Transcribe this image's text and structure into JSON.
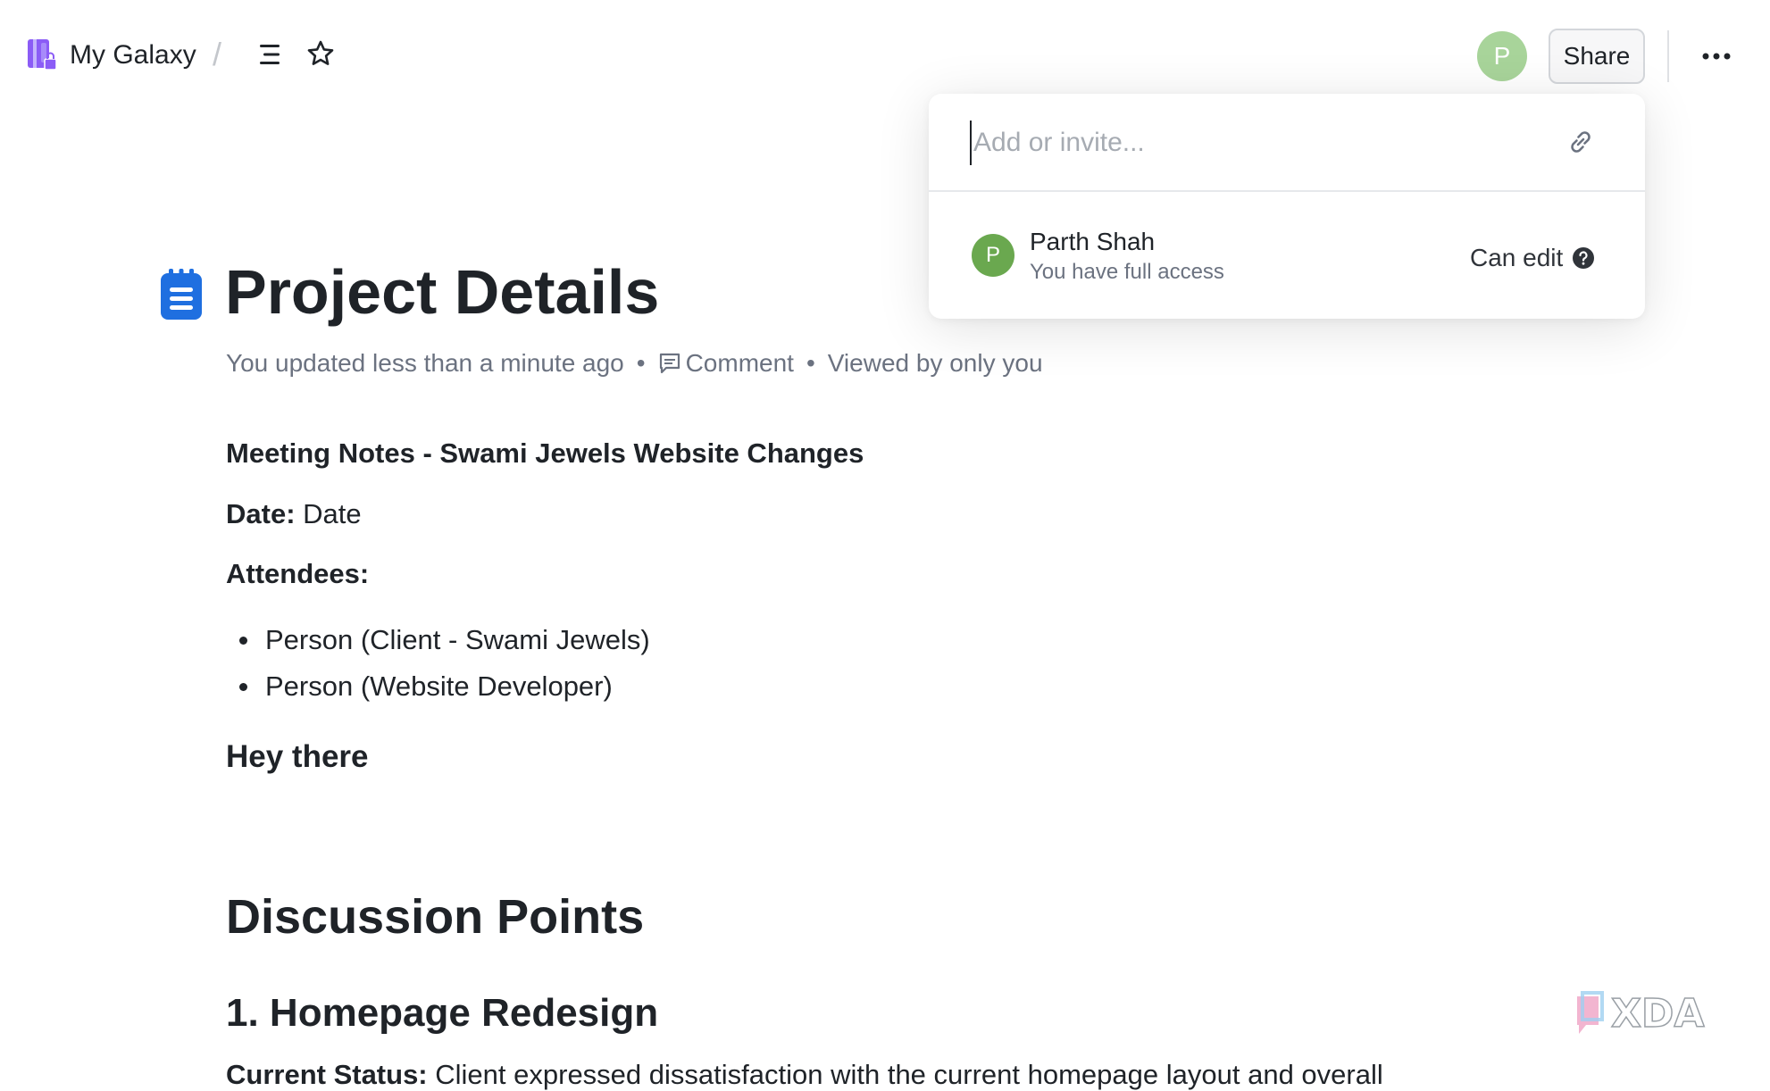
{
  "topbar": {
    "workspace_name": "My Galaxy",
    "breadcrumb_separator": "/",
    "avatar_initial": "P",
    "share_label": "Share"
  },
  "share_popover": {
    "invite_placeholder": "Add or invite...",
    "member": {
      "avatar_initial": "P",
      "name": "Parth Shah",
      "subtitle": "You have full access",
      "permission": "Can edit"
    }
  },
  "document": {
    "title": "Project Details",
    "meta": {
      "updated": "You updated less than a minute ago",
      "separator": "•",
      "comment_label": "Comment",
      "viewed": "Viewed by only you"
    },
    "meeting_heading": "Meeting Notes - Swami Jewels Website Changes",
    "date_label": "Date:",
    "date_value": "Date",
    "attendees_label": "Attendees:",
    "attendees": [
      "Person (Client - Swami Jewels)",
      "Person (Website Developer)"
    ],
    "greeting": "Hey there",
    "discussion_heading": "Discussion Points",
    "homepage_heading": "1. Homepage Redesign",
    "current_status_label": "Current Status:",
    "current_status_text": "Client expressed dissatisfaction with the current homepage layout and overall"
  },
  "colors": {
    "brand_purple": "#8b5cf6",
    "doc_icon_blue": "#1f6fe0",
    "top_avatar_green": "#a8d49a",
    "member_avatar_green": "#6aa84f"
  },
  "icons": {
    "brand": "notebook-lock-icon",
    "menu": "hamburger-icon",
    "favorite": "star-icon",
    "more": "more-horizontal-icon",
    "link": "link-icon",
    "help": "question-circle-icon",
    "document": "clipboard-doc-icon",
    "comment": "comment-icon"
  }
}
